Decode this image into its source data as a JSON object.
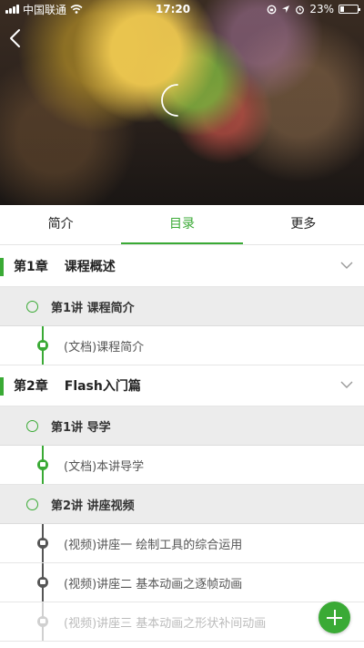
{
  "status_bar": {
    "carrier": "中国联通",
    "time": "17:20",
    "battery_text": "23%",
    "battery_level": 0.23
  },
  "tabs": [
    {
      "label": "简介",
      "active": false
    },
    {
      "label": "目录",
      "active": true
    },
    {
      "label": "更多",
      "active": false
    }
  ],
  "colors": {
    "accent": "#3aaa35"
  },
  "icons": {
    "back": "back-arrow-icon",
    "loading": "loading-spinner-icon",
    "fab": "plus-icon"
  },
  "chapters": [
    {
      "number": "第1章",
      "title": "课程概述",
      "lectures": [
        {
          "label": "第1讲 课程简介",
          "items": [
            {
              "label": "(文档)课程简介",
              "type": "doc"
            }
          ]
        }
      ]
    },
    {
      "number": "第2章",
      "title": "Flash入门篇",
      "lectures": [
        {
          "label": "第1讲 导学",
          "items": [
            {
              "label": "(文档)本讲导学",
              "type": "doc"
            }
          ]
        },
        {
          "label": "第2讲 讲座视频",
          "items": [
            {
              "label": "(视频)讲座一 绘制工具的综合运用",
              "type": "video"
            },
            {
              "label": "(视频)讲座二 基本动画之逐帧动画",
              "type": "video"
            },
            {
              "label": "(视频)讲座三 基本动画之形状补间动画",
              "type": "video"
            }
          ]
        }
      ]
    }
  ]
}
